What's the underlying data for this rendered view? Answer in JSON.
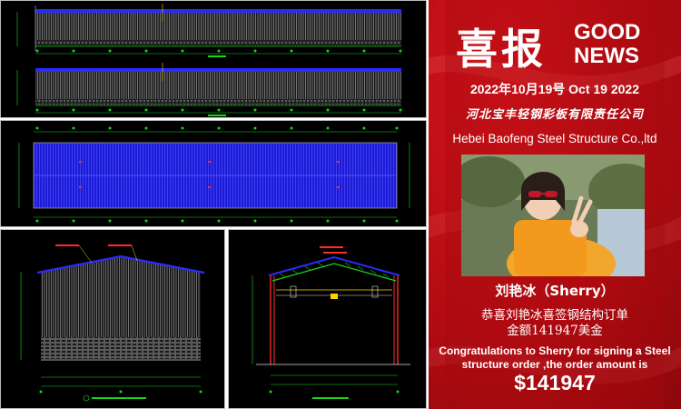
{
  "news": {
    "title_cn": "喜报",
    "title_en_1": "GOOD",
    "title_en_2": "NEWS",
    "date": "2022年10月19号   Oct 19 2022",
    "company_cn": "河北宝丰轻钢彩板有限责任公司",
    "company_en": "Hebei Baofeng Steel Structure Co.,ltd",
    "person_name": "刘艳冰（Sherry）",
    "message_cn_1": "恭喜刘艳冰喜签钢结构订单",
    "message_cn_2": "金额141947美金",
    "message_en_1": "Congratulations to Sherry  for signing a  Steel",
    "message_en_2": "structure order  ,the order amount is",
    "amount": "$141947"
  },
  "colors": {
    "accent_red": "#c8101a",
    "drawing_bg": "#000000",
    "roof_blue": "#2a2aff",
    "cad_green": "#19d419",
    "cad_red": "#ff2a2a"
  }
}
